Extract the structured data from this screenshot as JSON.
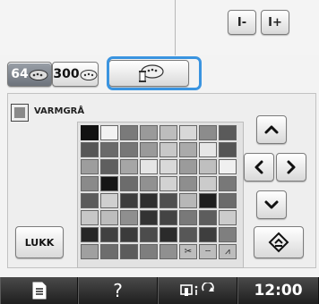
{
  "toolbar": {
    "spool_minus_label": "I-",
    "spool_plus_label": "I+"
  },
  "tabs": [
    {
      "label": "64",
      "selected": false
    },
    {
      "label": "300",
      "selected": false
    },
    {
      "label": "",
      "selected": true
    }
  ],
  "thread": {
    "name": "VARMGRÅ"
  },
  "palette": {
    "rows": [
      [
        "#111111",
        "#f2f2f2",
        "#7a7a7a",
        "#9a9a9a",
        "#bdbdbd",
        "#d8d8d8",
        "#8c8c8c",
        "#5a5a5a"
      ],
      [
        "#575757",
        "#6a6a6a",
        "#777777",
        "#9a9a9a",
        "#c8c8c8",
        "#aaaaaa",
        "#e6e6e6",
        "#555555"
      ],
      [
        "#9d9d9d",
        "#5f5f5f",
        "#a6a6a6",
        "#e5e5e5",
        "#d9d9d9",
        "#9b9b9b",
        "#bfbfbf",
        "#f0f0f0"
      ],
      [
        "#8a8a8a",
        "#161616",
        "#6c6c6c",
        "#919191",
        "#d2d2d2",
        "#8e8e8e",
        "#cbcbcb",
        "#787878"
      ],
      [
        "#5b5b5b",
        "#cfcfcf",
        "#3d3d3d",
        "#2e2e2e",
        "#4f4f4f",
        "#b7b7b7",
        "#1e1e1e",
        "#6b6b6b"
      ],
      [
        "#c7c7c7",
        "#bdbdbd",
        "#8f8f8f",
        "#333333",
        "#444444",
        "#797979",
        "#5d5d5d",
        "#cccccc"
      ],
      [
        "#262626",
        "#414141",
        "#3b3b3b",
        "#4c4c4c",
        "#2b2b2b",
        "#575757",
        "#3e3e3e",
        "#7f7f7f"
      ],
      [
        "#a0a0a0",
        "#6d6d6d",
        "#5c5c5c",
        "#7e7e7e",
        "#909090",
        "icon:scissors",
        "icon:dash",
        "icon:stitch"
      ]
    ],
    "selected": [
      0,
      0
    ]
  },
  "buttons": {
    "close_label": "LUKK"
  },
  "footer": {
    "help_label": "?",
    "time": "12:00"
  },
  "icons": {
    "spool_minus": "spool-minus-icon",
    "spool_plus": "spool-plus-icon",
    "palette_64": "palette-64-icon",
    "palette_300": "palette-300-icon",
    "custom_thread": "custom-thread-icon",
    "up": "chevron-up-icon",
    "left": "chevron-left-icon",
    "right": "chevron-right-icon",
    "down": "chevron-down-icon",
    "set": "set-icon",
    "document": "document-icon",
    "machine_status": "machine-status-icon"
  },
  "colors": {
    "highlight": "#3a94e0",
    "footer_bg": "#2a2a2a"
  }
}
